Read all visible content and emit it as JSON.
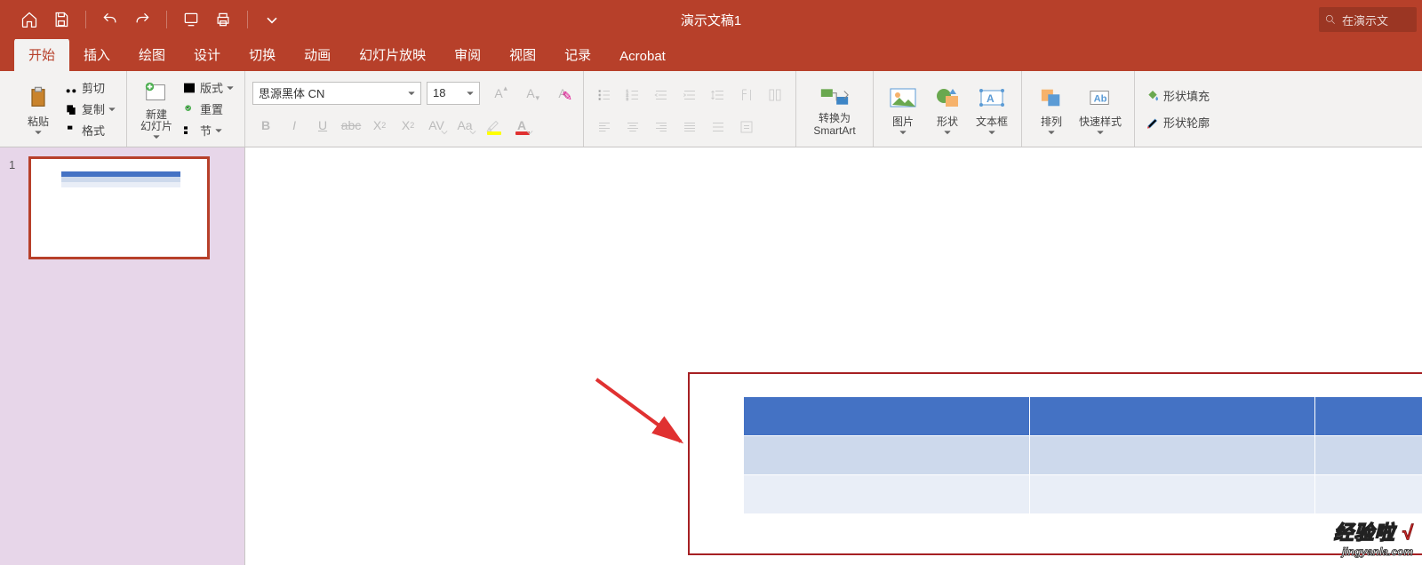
{
  "app": {
    "title": "演示文稿1",
    "search_placeholder": "在演示文"
  },
  "qat": {
    "home_icon": "home",
    "save_icon": "save",
    "undo_icon": "undo",
    "redo_icon": "redo",
    "touch_icon": "touch-mode",
    "print_icon": "print",
    "customize_icon": "customize"
  },
  "tabs": [
    {
      "id": "home",
      "label": "开始",
      "active": true
    },
    {
      "id": "insert",
      "label": "插入"
    },
    {
      "id": "draw",
      "label": "绘图"
    },
    {
      "id": "design",
      "label": "设计"
    },
    {
      "id": "transition",
      "label": "切换"
    },
    {
      "id": "animation",
      "label": "动画"
    },
    {
      "id": "slideshow",
      "label": "幻灯片放映"
    },
    {
      "id": "review",
      "label": "审阅"
    },
    {
      "id": "view",
      "label": "视图"
    },
    {
      "id": "record",
      "label": "记录"
    },
    {
      "id": "acrobat",
      "label": "Acrobat"
    }
  ],
  "ribbon": {
    "clipboard": {
      "paste": "粘贴",
      "cut": "剪切",
      "copy": "复制",
      "format": "格式"
    },
    "slides": {
      "new_slide": "新建\n幻灯片",
      "layout": "版式",
      "reset": "重置",
      "section": "节"
    },
    "font": {
      "name": "思源黑体 CN",
      "size": "18"
    },
    "smartart": {
      "label": "转换为\nSmartArt"
    },
    "insert_group": {
      "picture": "图片",
      "shapes": "形状",
      "textbox": "文本框"
    },
    "arrange_group": {
      "arrange": "排列",
      "quick_styles": "快速样式"
    },
    "shape_style": {
      "fill": "形状填充",
      "outline": "形状轮廓"
    }
  },
  "panel": {
    "slide_number": "1"
  },
  "watermark": {
    "line1": "经验啦",
    "check": "√",
    "line2": "jingyanla.com"
  }
}
